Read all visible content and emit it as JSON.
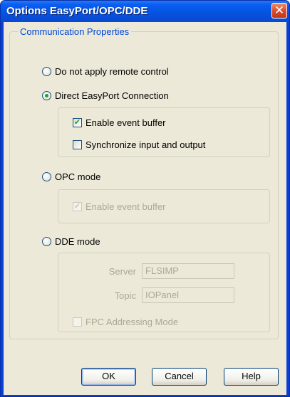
{
  "window": {
    "title": "Options EasyPort/OPC/DDE",
    "close_glyph": "✕"
  },
  "group": {
    "title": "Communication Properties"
  },
  "modes": {
    "none": {
      "label": "Do not apply remote control",
      "selected": false
    },
    "easyport": {
      "label": "Direct EasyPort Connection",
      "selected": true
    },
    "opc": {
      "label": "OPC mode",
      "selected": false
    },
    "dde": {
      "label": "DDE mode",
      "selected": false
    }
  },
  "easyport_options": {
    "event_buffer": {
      "label": "Enable event buffer",
      "checked": true
    },
    "sync": {
      "label": "Synchronize input and output",
      "checked": false
    }
  },
  "opc_options": {
    "event_buffer": {
      "label": "Enable event buffer",
      "checked": true,
      "enabled": false
    }
  },
  "dde_options": {
    "server_label": "Server",
    "server_value": "FLSIMP",
    "topic_label": "Topic",
    "topic_value": "IOPanel",
    "fpc": {
      "label": "FPC Addressing Mode",
      "checked": false,
      "enabled": false
    }
  },
  "buttons": {
    "ok": "OK",
    "cancel": "Cancel",
    "help": "Help"
  },
  "icons": {
    "check_glyph": "✔"
  }
}
